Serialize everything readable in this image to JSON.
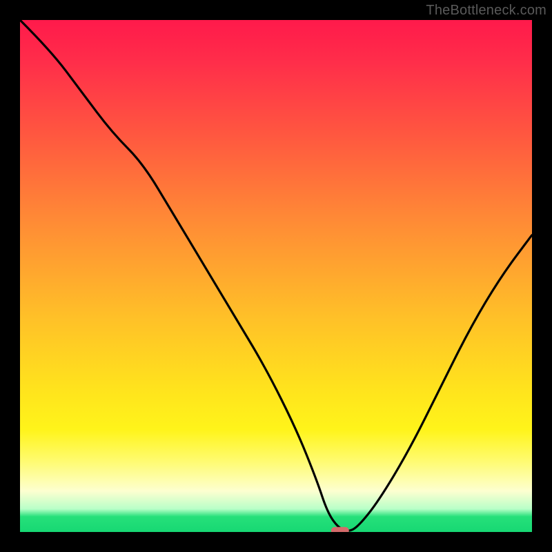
{
  "watermark": {
    "text": "TheBottleneck.com"
  },
  "colors": {
    "curve": "#000000",
    "marker_fill": "#d46a6a",
    "marker_stroke": "#b94e4e",
    "background": "#000000"
  },
  "chart_data": {
    "type": "line",
    "title": "",
    "xlabel": "",
    "ylabel": "",
    "xlim": [
      0,
      100
    ],
    "ylim": [
      0,
      100
    ],
    "grid": false,
    "legend": false,
    "annotations": [
      {
        "type": "marker",
        "shape": "pill",
        "x": 62.5,
        "y": 0,
        "width_x_units": 3.5,
        "height_y_units": 1.4
      }
    ],
    "series": [
      {
        "name": "bottleneck-curve",
        "x": [
          0,
          6,
          12,
          18,
          24,
          30,
          36,
          42,
          48,
          54,
          58,
          60,
          62,
          64,
          66,
          70,
          76,
          82,
          88,
          94,
          100
        ],
        "values": [
          100,
          94,
          86,
          78,
          72,
          62,
          52,
          42,
          32,
          20,
          10,
          4,
          1,
          0,
          1,
          6,
          16,
          28,
          40,
          50,
          58
        ]
      }
    ]
  }
}
